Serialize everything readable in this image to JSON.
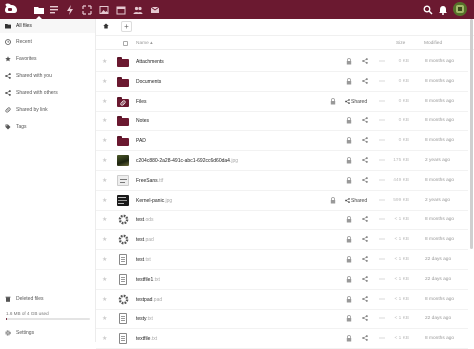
{
  "header": {
    "apps": [
      "files-icon",
      "activity-icon",
      "flash-icon",
      "gallery-icon",
      "photos-icon",
      "calendar-icon",
      "contacts-icon",
      "mail-icon"
    ],
    "right_icons": [
      "search-icon",
      "notifications-icon",
      "avatar"
    ]
  },
  "sidebar": {
    "items": [
      {
        "label": "All files",
        "icon": "folder-icon",
        "active": true
      },
      {
        "label": "Recent",
        "icon": "clock-icon"
      },
      {
        "label": "Favorites",
        "icon": "star-icon"
      },
      {
        "label": "Shared with you",
        "icon": "share-icon"
      },
      {
        "label": "Shared with others",
        "icon": "share-icon"
      },
      {
        "label": "Shared by link",
        "icon": "link-icon"
      },
      {
        "label": "Tags",
        "icon": "tag-icon"
      }
    ],
    "deleted": "Deleted files",
    "quota": "1.6 MB of 4 GB used",
    "quota_fraction": 0.0004,
    "settings": "Settings"
  },
  "main": {
    "add_label": "+",
    "columns": {
      "name": "Name",
      "size": "Size",
      "modified": "Modified"
    },
    "sort_arrow": "▴",
    "files": [
      {
        "name": "Attachments",
        "ext": "",
        "type": "folder",
        "size": "0 KB",
        "modified": "8 months ago",
        "shared": false
      },
      {
        "name": "Documents",
        "ext": "",
        "type": "folder",
        "size": "0 KB",
        "modified": "8 months ago",
        "shared": false
      },
      {
        "name": "Files",
        "ext": "",
        "type": "folder-shared",
        "size": "0 KB",
        "modified": "8 months ago",
        "shared": true
      },
      {
        "name": "Notes",
        "ext": "",
        "type": "folder",
        "size": "0 KB",
        "modified": "8 months ago",
        "shared": false
      },
      {
        "name": "PAD",
        "ext": "",
        "type": "folder",
        "size": "0 KB",
        "modified": "8 months ago",
        "shared": false
      },
      {
        "name": "c204c880-2a28-491c-abc1-692cc6d60da4",
        "ext": ".jpg",
        "type": "image-dark",
        "size": "175 KB",
        "modified": "2 years ago",
        "shared": false
      },
      {
        "name": "FreeSans",
        "ext": ".ttf",
        "type": "image-font",
        "size": "449 KB",
        "modified": "8 months ago",
        "shared": false
      },
      {
        "name": "Kernel-panic",
        "ext": ".jpg",
        "type": "image-kernel",
        "size": "599 KB",
        "modified": "2 years ago",
        "shared": true
      },
      {
        "name": "test",
        "ext": ".ods",
        "type": "gear",
        "size": "< 1 KB",
        "modified": "8 months ago",
        "shared": false
      },
      {
        "name": "test",
        "ext": ".pad",
        "type": "gear",
        "size": "< 1 KB",
        "modified": "8 months ago",
        "shared": false
      },
      {
        "name": "test",
        "ext": ".txt",
        "type": "doc",
        "size": "< 1 KB",
        "modified": "22 days ago",
        "shared": false
      },
      {
        "name": "testfile1",
        "ext": ".txt",
        "type": "doc",
        "size": "< 1 KB",
        "modified": "22 days ago",
        "shared": false
      },
      {
        "name": "testpad",
        "ext": ".pad",
        "type": "gear",
        "size": "< 1 KB",
        "modified": "8 months ago",
        "shared": false
      },
      {
        "name": "testy",
        "ext": ".txt",
        "type": "doc",
        "size": "< 1 KB",
        "modified": "22 days ago",
        "shared": false
      },
      {
        "name": "textfile",
        "ext": ".txt",
        "type": "doc",
        "size": "< 1 KB",
        "modified": "8 months ago",
        "shared": false
      }
    ],
    "shared_label": "Shared"
  },
  "colors": {
    "brand": "#6b1930",
    "text": "#222222",
    "muted": "#999999"
  }
}
